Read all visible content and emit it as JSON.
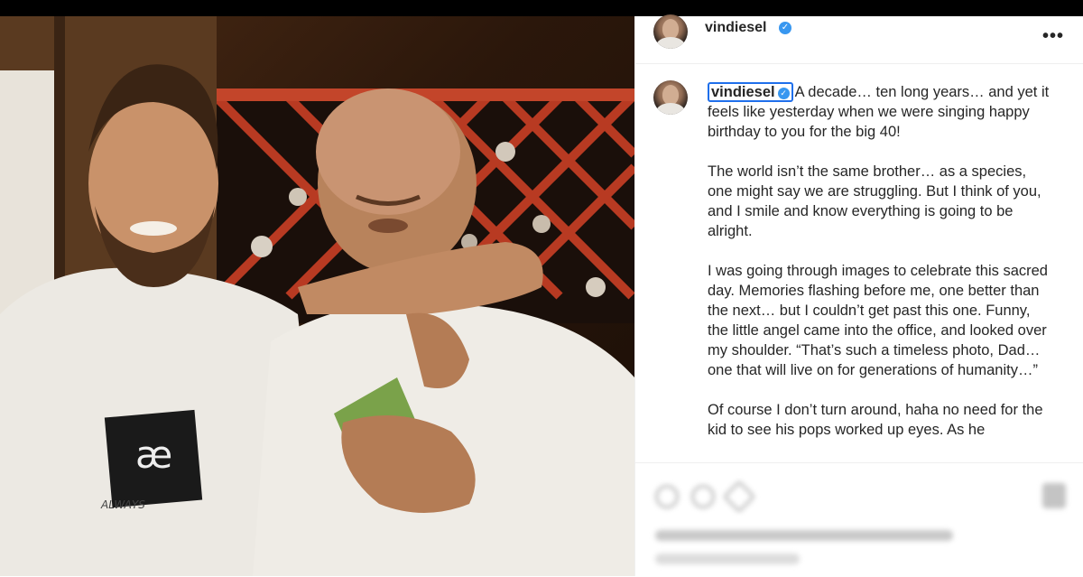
{
  "post": {
    "username": "vindiesel",
    "more_label": "•••",
    "verified_mark": "✓",
    "caption_paragraphs": [
      "A decade… ten long years… and yet it feels like yesterday when we were singing happy birthday to you for the big 40!",
      "The world isn’t the same brother… as a species, one might say we are struggling. But I think of you, and I smile and know everything is going to be alright.",
      "I was going through images to celebrate this sacred day. Memories flashing before me, one better than the next… but I couldn’t get past this one. Funny, the little angel came into the office, and looked over my shoulder. “That’s such a timeless photo, Dad… one that will live on for generations of humanity…”",
      "Of course I don’t turn around, haha no need for the kid to see his pops worked up eyes. As he"
    ]
  },
  "photo": {
    "shirt_logo_text": "æ",
    "shirt_brand_text": "ALWAYS"
  },
  "icons": {
    "verified": "verified-badge-icon",
    "more": "more-options-icon",
    "like": "heart-icon",
    "comment": "comment-icon",
    "share": "share-icon",
    "save": "bookmark-icon"
  },
  "colors": {
    "verified": "#3897f0",
    "selection_outline": "#1f6feb",
    "text": "#262626",
    "divider": "#efefef"
  }
}
